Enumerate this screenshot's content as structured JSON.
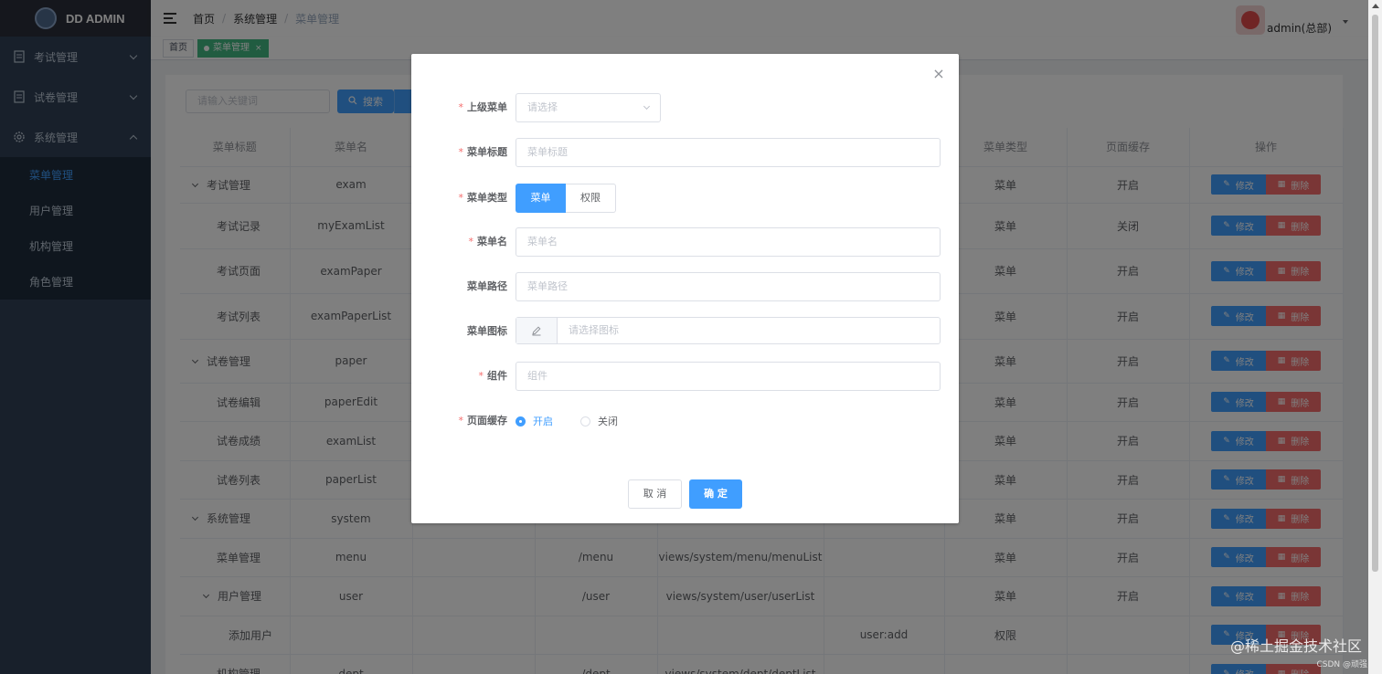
{
  "app": {
    "logo_text": "DD ADMIN"
  },
  "sidebar": {
    "groups": [
      {
        "label": "考试管理",
        "expanded": false
      },
      {
        "label": "试卷管理",
        "expanded": false
      },
      {
        "label": "系统管理",
        "expanded": true
      }
    ],
    "sub_items": [
      "菜单管理",
      "用户管理",
      "机构管理",
      "角色管理"
    ],
    "active_sub": "菜单管理"
  },
  "navbar": {
    "breadcrumb": [
      "首页",
      "系统管理",
      "菜单管理"
    ],
    "user_name": "admin(总部)"
  },
  "tags": {
    "home": "首页",
    "active": "菜单管理",
    "close": "×"
  },
  "search": {
    "placeholder": "请输入关键词",
    "button": "搜索"
  },
  "table": {
    "headers": [
      "菜单标题",
      "菜单名",
      "",
      "",
      "",
      "",
      "菜单类型",
      "页面缓存",
      "操作"
    ],
    "edit_label": "修改",
    "delete_label": "删除",
    "rows": [
      {
        "title": "考试管理",
        "tree": true,
        "name": "exam",
        "path": "",
        "component": "",
        "perm": "",
        "type": "菜单",
        "cache": "开启"
      },
      {
        "title": "考试记录",
        "name": "myExamList",
        "path": "",
        "component": "",
        "perm": "",
        "type": "菜单",
        "cache": "关闭"
      },
      {
        "title": "考试页面",
        "name": "examPaper",
        "path": "",
        "component": "",
        "perm": "",
        "type": "菜单",
        "cache": "开启"
      },
      {
        "title": "考试列表",
        "name": "examPaperList",
        "path": "",
        "component": "",
        "perm": "",
        "type": "菜单",
        "cache": "开启"
      },
      {
        "title": "试卷管理",
        "tree": true,
        "name": "paper",
        "path": "",
        "component": "",
        "perm": "",
        "type": "菜单",
        "cache": "开启"
      },
      {
        "title": "试卷编辑",
        "name": "paperEdit",
        "path": "",
        "component": "",
        "perm": "",
        "type": "菜单",
        "cache": "开启"
      },
      {
        "title": "试卷成绩",
        "name": "examList",
        "path": "",
        "component": "",
        "perm": "",
        "type": "菜单",
        "cache": "开启"
      },
      {
        "title": "试卷列表",
        "name": "paperList",
        "path": "",
        "component": "",
        "perm": "",
        "type": "菜单",
        "cache": "开启"
      },
      {
        "title": "系统管理",
        "tree": true,
        "name": "system",
        "path": "",
        "component": "",
        "perm": "",
        "type": "菜单",
        "cache": "开启"
      },
      {
        "title": "菜单管理",
        "name": "menu",
        "path": "/menu",
        "component": "views/system/menu/menuList",
        "perm": "",
        "type": "菜单",
        "cache": "开启"
      },
      {
        "title": "用户管理",
        "tree": true,
        "name": "user",
        "path": "/user",
        "component": "views/system/user/userList",
        "perm": "",
        "type": "菜单",
        "cache": "开启"
      },
      {
        "title": "添加用户",
        "name": "",
        "path": "",
        "component": "",
        "perm": "user:add",
        "type": "权限",
        "cache": ""
      },
      {
        "title": "机构管理",
        "name": "dept",
        "path": "/dept",
        "component": "views/system/dept/deptList",
        "perm": "",
        "type": "",
        "cache": ""
      }
    ]
  },
  "dialog": {
    "close": "×",
    "parent_label": "上级菜单",
    "parent_placeholder": "请选择",
    "title_label": "菜单标题",
    "title_placeholder": "菜单标题",
    "type_label": "菜单类型",
    "type_options": [
      "菜单",
      "权限"
    ],
    "name_label": "菜单名",
    "name_placeholder": "菜单名",
    "path_label": "菜单路径",
    "path_placeholder": "菜单路径",
    "icon_label": "菜单图标",
    "icon_placeholder": "请选择图标",
    "component_label": "组件",
    "component_placeholder": "组件",
    "cache_label": "页面缓存",
    "cache_options": [
      "开启",
      "关闭"
    ],
    "cancel": "取 消",
    "confirm": "确 定"
  },
  "watermark": {
    "main": "@稀土掘金技术社区",
    "sub": "CSDN @顽强"
  },
  "colors": {
    "primary": "#409eff",
    "danger": "#f56c6c",
    "sidebar": "#304156",
    "tag_active": "#42b983"
  }
}
